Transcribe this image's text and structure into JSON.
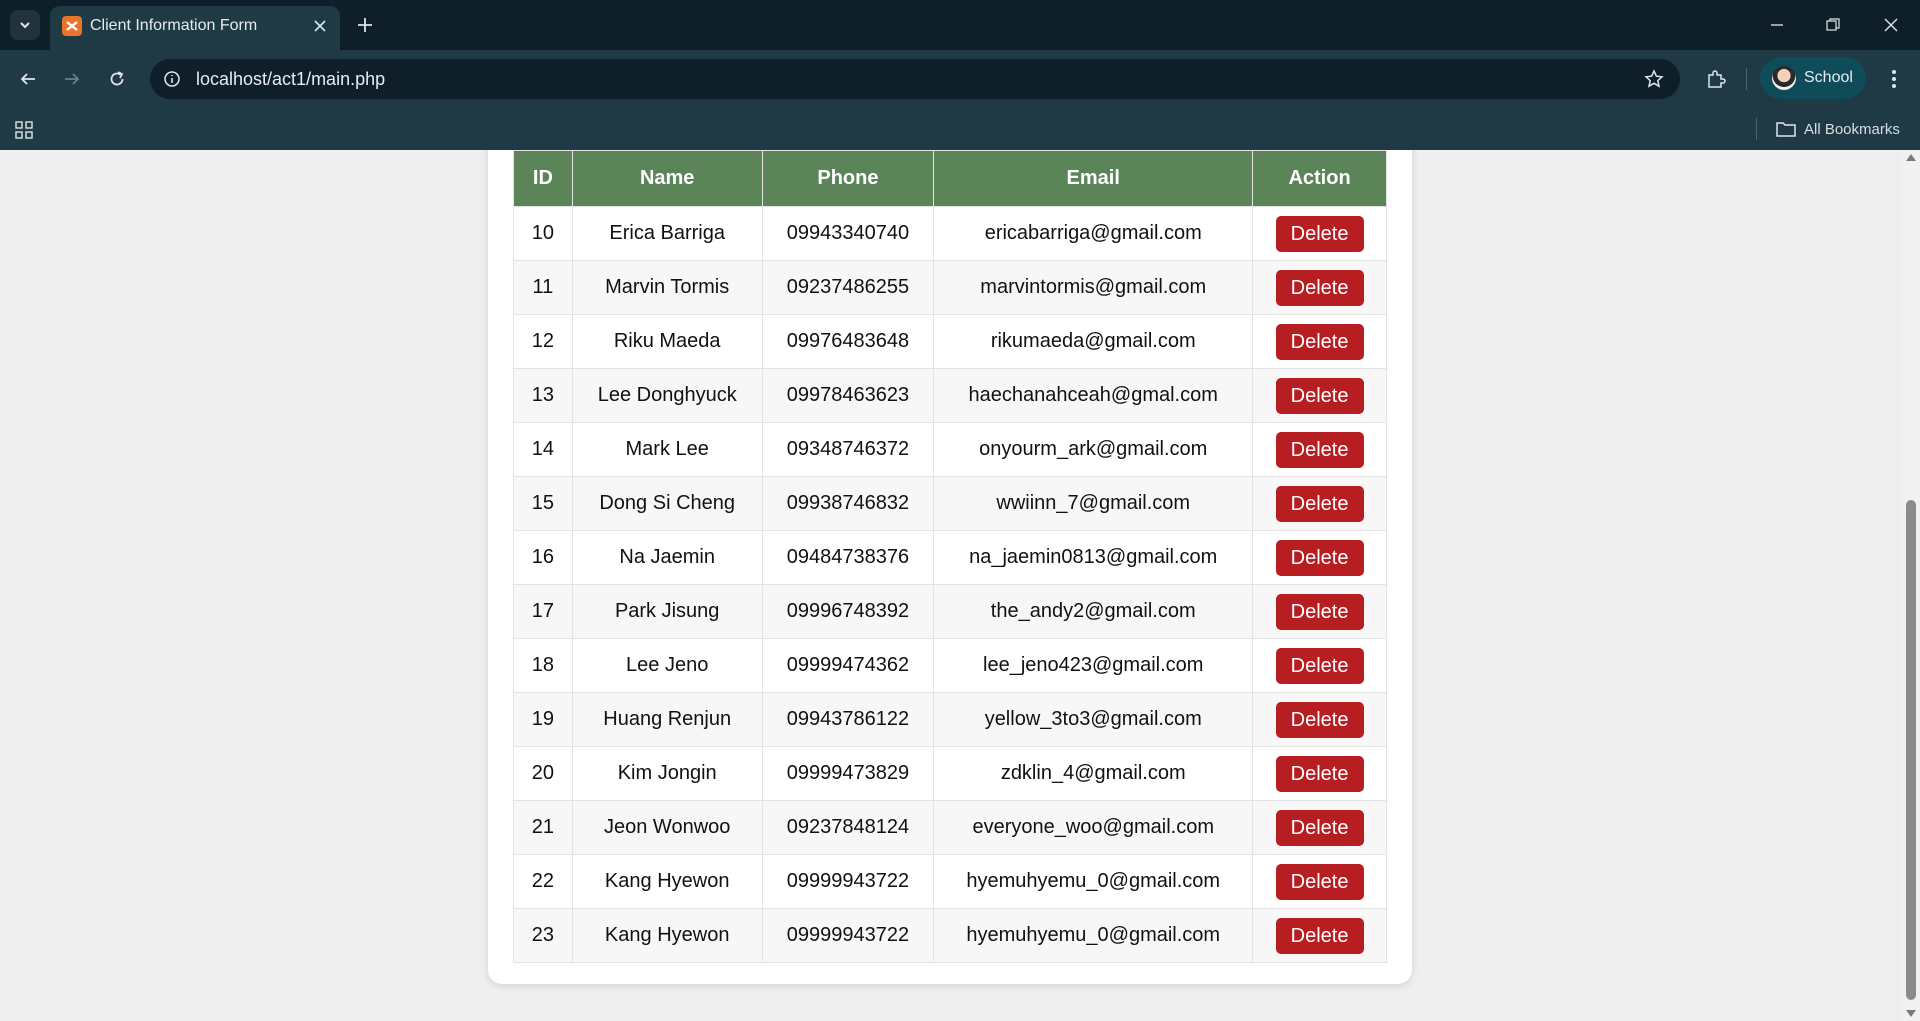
{
  "browser": {
    "tab_title": "Client Information Form",
    "url": "localhost/act1/main.php",
    "profile_label": "School",
    "all_bookmarks_label": "All Bookmarks"
  },
  "table": {
    "headers": [
      "ID",
      "Name",
      "Phone",
      "Email",
      "Action"
    ],
    "delete_label": "Delete",
    "rows": [
      {
        "id": "10",
        "name": "Erica Barriga",
        "phone": "09943340740",
        "email": "ericabarriga@gmail.com"
      },
      {
        "id": "11",
        "name": "Marvin Tormis",
        "phone": "09237486255",
        "email": "marvintormis@gmail.com"
      },
      {
        "id": "12",
        "name": "Riku Maeda",
        "phone": "09976483648",
        "email": "rikumaeda@gmail.com"
      },
      {
        "id": "13",
        "name": "Lee Donghyuck",
        "phone": "09978463623",
        "email": "haechanahceah@gmal.com"
      },
      {
        "id": "14",
        "name": "Mark Lee",
        "phone": "09348746372",
        "email": "onyourm_ark@gmail.com"
      },
      {
        "id": "15",
        "name": "Dong Si Cheng",
        "phone": "09938746832",
        "email": "wwiinn_7@gmail.com"
      },
      {
        "id": "16",
        "name": "Na Jaemin",
        "phone": "09484738376",
        "email": "na_jaemin0813@gmail.com"
      },
      {
        "id": "17",
        "name": "Park Jisung",
        "phone": "09996748392",
        "email": "the_andy2@gmail.com"
      },
      {
        "id": "18",
        "name": "Lee Jeno",
        "phone": "09999474362",
        "email": "lee_jeno423@gmail.com"
      },
      {
        "id": "19",
        "name": "Huang Renjun",
        "phone": "09943786122",
        "email": "yellow_3to3@gmail.com"
      },
      {
        "id": "20",
        "name": "Kim Jongin",
        "phone": "09999473829",
        "email": "zdklin_4@gmail.com"
      },
      {
        "id": "21",
        "name": "Jeon Wonwoo",
        "phone": "09237848124",
        "email": "everyone_woo@gmail.com"
      },
      {
        "id": "22",
        "name": "Kang Hyewon",
        "phone": "09999943722",
        "email": "hyemuhyemu_0@gmail.com"
      },
      {
        "id": "23",
        "name": "Kang Hyewon",
        "phone": "09999943722",
        "email": "hyemuhyemu_0@gmail.com"
      }
    ]
  }
}
